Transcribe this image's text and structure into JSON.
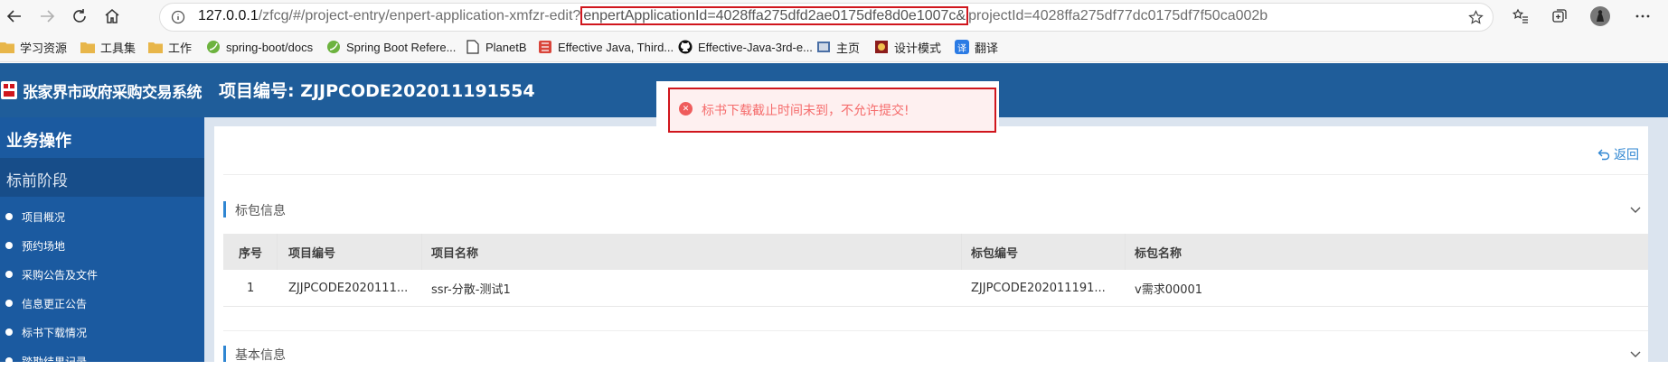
{
  "browser": {
    "url_host": "127.0.0.1",
    "url_path": "/zfcg/#/project-entry/enpert-application-xmfzr-edit?",
    "url_highlight": "enpertApplicationId=4028ffa275dfd2ae0175dfe8d0e1007c&",
    "url_tail": "projectId=4028ffa275df77dc0175df7f50ca002b",
    "bookmarks": [
      {
        "label": "学习资源",
        "icon": "folder-icon"
      },
      {
        "label": "工具集",
        "icon": "folder-icon"
      },
      {
        "label": "工作",
        "icon": "folder-icon"
      },
      {
        "label": "spring-boot/docs",
        "icon": "spring-icon"
      },
      {
        "label": "Spring Boot Refere...",
        "icon": "spring-icon"
      },
      {
        "label": "PlanetB",
        "icon": "page-icon"
      },
      {
        "label": "Effective Java, Third...",
        "icon": "book-icon"
      },
      {
        "label": "Effective-Java-3rd-e...",
        "icon": "github-icon"
      },
      {
        "label": "主页",
        "icon": "home-page-icon"
      },
      {
        "label": "设计模式",
        "icon": "design-icon"
      },
      {
        "label": "翻译",
        "icon": "translate-icon"
      }
    ],
    "translate_badge": "译"
  },
  "header": {
    "system_title": "张家界市政府采购交易系统",
    "project_title": "项目编号: ZJJPCODE202011191554"
  },
  "sidebar": {
    "title": "业务操作",
    "stage": "标前阶段",
    "items": [
      {
        "label": "项目概况"
      },
      {
        "label": "预约场地"
      },
      {
        "label": "采购公告及文件"
      },
      {
        "label": "信息更正公告"
      },
      {
        "label": "标书下载情况"
      },
      {
        "label": "踏勘结果记录"
      }
    ]
  },
  "content": {
    "back_label": "返回",
    "section_package": "标包信息",
    "section_basic": "基本信息",
    "table": {
      "headers": [
        "序号",
        "项目编号",
        "项目名称",
        "标包编号",
        "标包名称"
      ],
      "rows": [
        [
          "1",
          "ZJJPCODE2020111...",
          "ssr-分散-测试1",
          "ZJJPCODE202011191...",
          "v需求00001"
        ]
      ]
    }
  },
  "toast": {
    "message": "标书下载截止时间未到，不允许提交!",
    "icon": "close-circle-icon"
  },
  "colors": {
    "header_blue": "#1f5d9a",
    "sidebar_blue": "#1b5aa0",
    "accent": "#2f86d2",
    "error_red": "#f56c6c",
    "highlight_red": "#d0161d"
  }
}
